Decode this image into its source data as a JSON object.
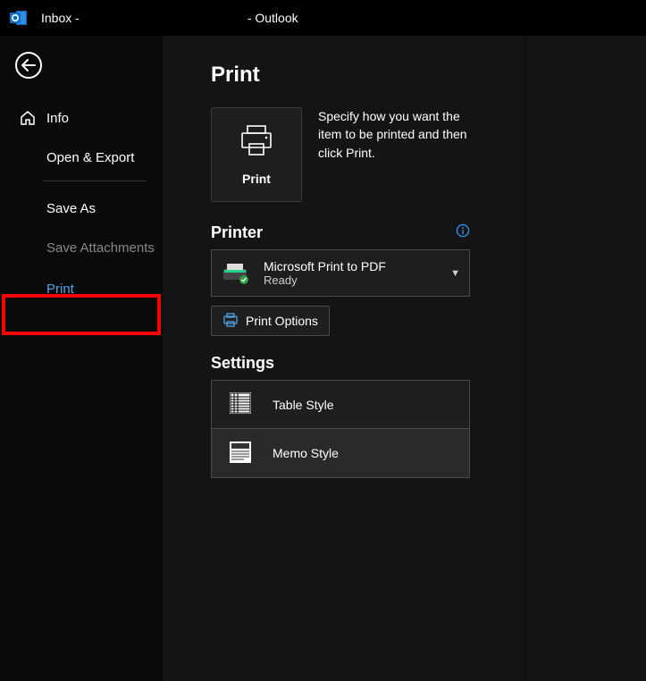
{
  "titlebar": {
    "prefix": "Inbox - ",
    "suffix": " -  Outlook"
  },
  "sidebar": {
    "info": "Info",
    "open_export": "Open & Export",
    "save_as": "Save As",
    "save_attachments": "Save Attachments",
    "print": "Print"
  },
  "page": {
    "title": "Print",
    "print_button": "Print",
    "print_description": "Specify how you want the item to be printed and then click Print."
  },
  "printer": {
    "heading": "Printer",
    "selected_name": "Microsoft Print to PDF",
    "selected_status": "Ready",
    "options_button": "Print Options"
  },
  "settings": {
    "heading": "Settings",
    "table_style": "Table Style",
    "memo_style": "Memo Style"
  }
}
